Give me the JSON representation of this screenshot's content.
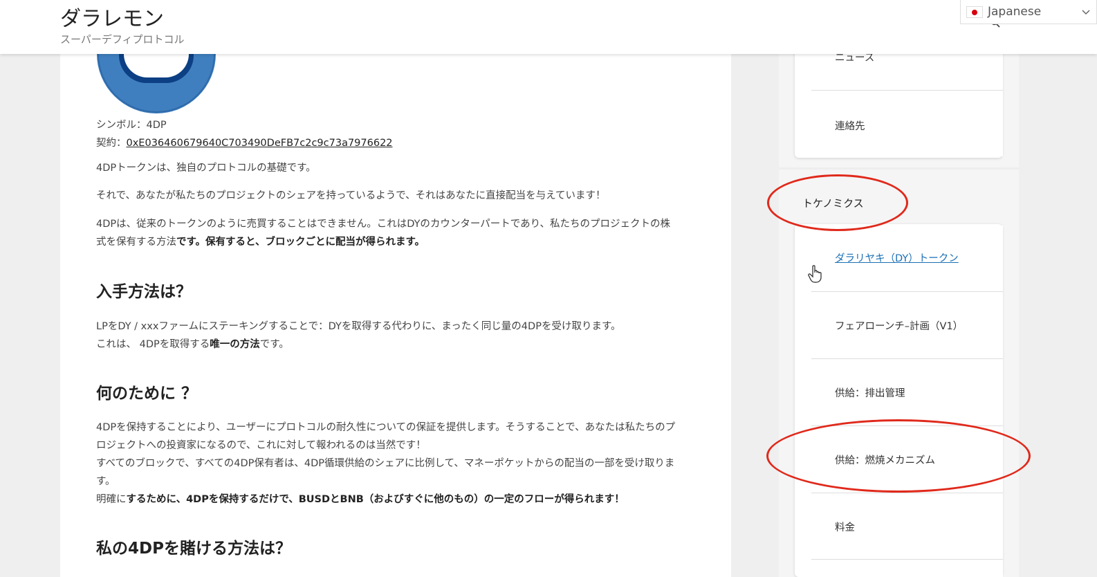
{
  "header": {
    "site_title": "ダラレモン",
    "tagline": "スーパーデフィプロトコル"
  },
  "language": {
    "selected": "Japanese"
  },
  "article": {
    "symbol_line": "シンボル：4DP",
    "contract_label": "契約：",
    "contract_address": "0xE036460679640C703490DeFB7c2c9c73a7976622",
    "intro": "4DPトークンは、独自のプロトコルの基礎です。",
    "share": "それで、あなたが私たちのプロジェクトのシェアを持っているようで、それはあなたに直接配当を与えています！",
    "no_trade_1": "4DPは、従来のトークンのように売買することはできません。これはDYのカウンターパートであり、私たちのプロジェクトの株",
    "no_trade_2a": "式を保有する方法",
    "no_trade_2b": "です。保有すると、ブロックごとに配当が得られます。",
    "h_how_get": "入手方法は？",
    "get_1": "LPをDY / xxxファームにステーキングすることで：DYを取得する代わりに、まったく同じ量の4DPを受け取ります。",
    "get_2a": "これは、 4DPを取得する",
    "get_2b": "唯一の方法",
    "get_2c": "です。",
    "h_why": "何のために ？",
    "why_1": "4DPを保持することにより、ユーザーにプロトコルの耐久性についての保証を提供します。そうすることで、あなたは私たちのプ",
    "why_2": "ロジェクトへの投資家になるので、これに対して報われるのは当然です！",
    "why_3": "すべてのブロックで、すべての4DP保有者は、4DP循環供給のシェアに比例して、マネーポケットからの配当の一部を受け取りま",
    "why_4": "す。",
    "why_5a": "明確に",
    "why_5b": "するために、4DPを保持するだけで、BUSDとBNB（およびすぐに他のもの）の一定のフローが得られます！",
    "h_bet": "私の4DPを賭ける方法は？"
  },
  "sidebar": {
    "top_items": [
      "ニュース",
      "連絡先"
    ],
    "widget_title": "トケノミクス",
    "items": [
      "ダラリヤキ（DY）トークン",
      "フェアローンチ–計画（V1）",
      "供給：排出管理",
      "供給：燃焼メカニズム",
      "料金"
    ]
  },
  "colors": {
    "annotation_red": "#e0291b",
    "link_blue": "#1a6fb5",
    "logo_blue": "#3f7fc0"
  }
}
